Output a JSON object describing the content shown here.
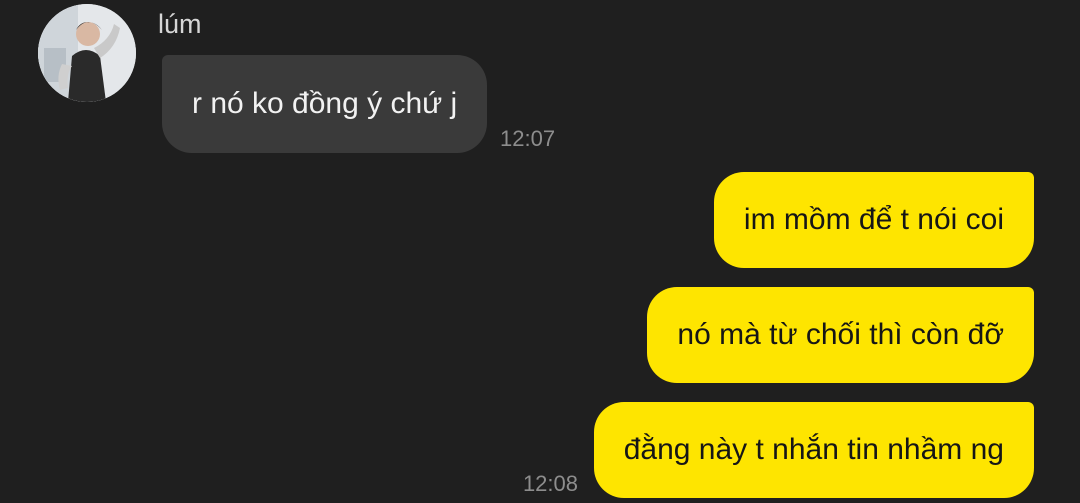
{
  "conversation": {
    "contact_name": "lúm",
    "incoming": [
      {
        "text": "r nó ko đồng ý chứ j",
        "time": "12:07"
      }
    ],
    "outgoing": [
      {
        "text": "im mồm để t nói coi"
      },
      {
        "text": "nó mà từ chối thì còn đỡ"
      },
      {
        "text": "đằng này t nhắn tin nhầm ng"
      }
    ],
    "outgoing_time": "12:08"
  },
  "colors": {
    "background": "#1f1f1f",
    "incoming_bubble": "#3a3a3a",
    "outgoing_bubble": "#fee500",
    "timestamp": "#8d8d8d"
  }
}
